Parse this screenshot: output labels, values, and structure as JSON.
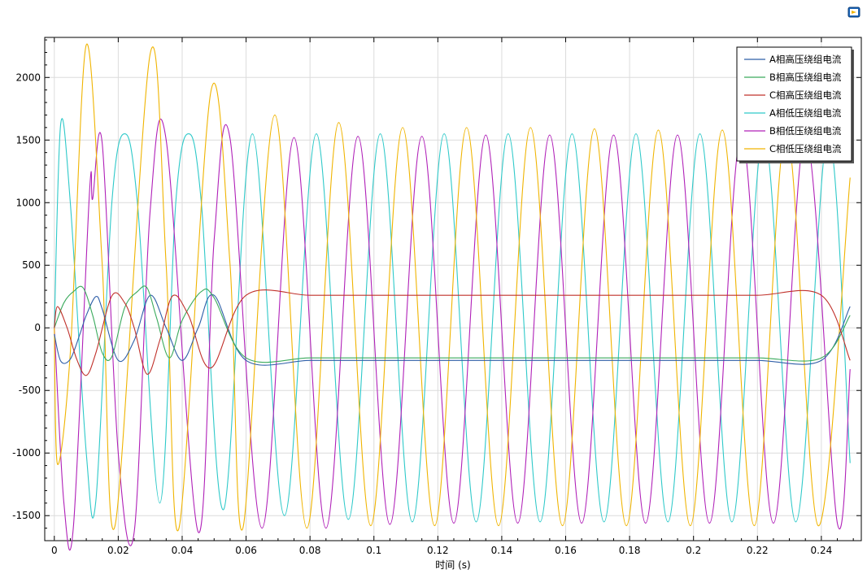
{
  "chart_data": {
    "type": "line",
    "xlabel": "时间 (s)",
    "ylabel": "",
    "xlim": [
      -0.003,
      0.2525
    ],
    "ylim": [
      -1700,
      2320
    ],
    "xticks": [
      0,
      0.02,
      0.04,
      0.06,
      0.08,
      0.1,
      0.12,
      0.14,
      0.16,
      0.18,
      0.2,
      0.22,
      0.24
    ],
    "xtick_labels": [
      "0",
      "0.02",
      "0.04",
      "0.06",
      "0.08",
      "0.1",
      "0.12",
      "0.14",
      "0.16",
      "0.18",
      "0.2",
      "0.22",
      "0.24"
    ],
    "yticks": [
      -1500,
      -1000,
      -500,
      0,
      500,
      1000,
      1500,
      2000
    ],
    "ytick_labels": [
      "-1500",
      "-1000",
      "-500",
      "0",
      "500",
      "1000",
      "1500",
      "2000"
    ],
    "grid": true,
    "legend_position": "top-right",
    "series": [
      {
        "name": "A相高压绕组电流",
        "color": "#2f5fa8",
        "x": [
          0,
          0.002,
          0.005,
          0.008,
          0.01,
          0.013,
          0.015,
          0.02,
          0.025,
          0.03,
          0.035,
          0.04,
          0.045,
          0.05,
          0.06,
          0.08,
          0.1,
          0.12,
          0.14,
          0.16,
          0.18,
          0.2,
          0.22,
          0.24,
          0.249
        ],
        "y": [
          -50,
          -265,
          -250,
          -50,
          100,
          250,
          150,
          -260,
          -100,
          260,
          0,
          -260,
          0,
          260,
          -260,
          -260,
          -260,
          -260,
          -260,
          -260,
          -260,
          -260,
          -260,
          -260,
          170
        ]
      },
      {
        "name": "B相高压绕组电流",
        "color": "#3aaa5c",
        "x": [
          0,
          0.003,
          0.006,
          0.009,
          0.012,
          0.015,
          0.018,
          0.022,
          0.026,
          0.029,
          0.032,
          0.036,
          0.04,
          0.046,
          0.05,
          0.06,
          0.08,
          0.1,
          0.12,
          0.14,
          0.16,
          0.18,
          0.2,
          0.22,
          0.24,
          0.249
        ],
        "y": [
          0,
          200,
          290,
          320,
          100,
          -200,
          -230,
          160,
          290,
          320,
          80,
          -240,
          60,
          290,
          240,
          -240,
          -240,
          -240,
          -240,
          -240,
          -240,
          -240,
          -240,
          -240,
          -240,
          100
        ]
      },
      {
        "name": "C相高压绕组电流",
        "color": "#c0302a",
        "x": [
          0,
          0.001,
          0.004,
          0.007,
          0.01,
          0.013,
          0.018,
          0.022,
          0.025,
          0.029,
          0.033,
          0.037,
          0.042,
          0.049,
          0.06,
          0.08,
          0.1,
          0.12,
          0.14,
          0.16,
          0.18,
          0.2,
          0.22,
          0.24,
          0.249
        ],
        "y": [
          0,
          170,
          0,
          -250,
          -380,
          -200,
          255,
          200,
          0,
          -370,
          -100,
          255,
          100,
          -320,
          260,
          260,
          260,
          260,
          260,
          260,
          260,
          260,
          260,
          260,
          -260
        ]
      },
      {
        "name": "A相低压绕组电流",
        "color": "#2ec9c9",
        "x": [
          0,
          0.002,
          0.005,
          0.01,
          0.013,
          0.018,
          0.022,
          0.026,
          0.033,
          0.038,
          0.042,
          0.046,
          0.053,
          0.062,
          0.072,
          0.082,
          0.092,
          0.102,
          0.112,
          0.122,
          0.132,
          0.142,
          0.152,
          0.162,
          0.172,
          0.182,
          0.192,
          0.202,
          0.212,
          0.222,
          0.232,
          0.242,
          0.249
        ],
        "y": [
          0,
          1630,
          1000,
          -1000,
          -1380,
          1000,
          1550,
          1000,
          -1400,
          1000,
          1550,
          1000,
          -1450,
          1550,
          -1500,
          1550,
          -1530,
          1550,
          -1550,
          1550,
          -1550,
          1550,
          -1550,
          1550,
          -1550,
          1550,
          -1550,
          1550,
          -1550,
          1550,
          -1550,
          1550,
          -1080
        ]
      },
      {
        "name": "B相低压绕组电流",
        "color": "#b020b8",
        "x": [
          0,
          0.003,
          0.006,
          0.011,
          0.012,
          0.015,
          0.02,
          0.025,
          0.03,
          0.035,
          0.045,
          0.05,
          0.055,
          0.065,
          0.075,
          0.085,
          0.095,
          0.105,
          0.115,
          0.125,
          0.135,
          0.145,
          0.155,
          0.165,
          0.175,
          0.185,
          0.195,
          0.205,
          0.215,
          0.225,
          0.235,
          0.245,
          0.249
        ],
        "y": [
          0,
          -1400,
          -1580,
          1080,
          1030,
          1470,
          -1000,
          -1630,
          940,
          1500,
          -1630,
          700,
          1510,
          -1600,
          1520,
          -1600,
          1530,
          -1570,
          1530,
          -1560,
          1540,
          -1560,
          1540,
          -1560,
          1540,
          -1560,
          1540,
          -1560,
          1540,
          -1560,
          1540,
          -1560,
          -330
        ]
      },
      {
        "name": "C相低压绕组电流",
        "color": "#f0b400",
        "x": [
          0,
          0.001,
          0.005,
          0.01,
          0.015,
          0.019,
          0.03,
          0.035,
          0.039,
          0.049,
          0.055,
          0.059,
          0.069,
          0.079,
          0.089,
          0.099,
          0.109,
          0.119,
          0.129,
          0.139,
          0.149,
          0.159,
          0.169,
          0.179,
          0.189,
          0.199,
          0.209,
          0.219,
          0.229,
          0.239,
          0.249
        ],
        "y": [
          0,
          -1090,
          -200,
          2260,
          500,
          -1580,
          2190,
          500,
          -1600,
          1890,
          500,
          -1600,
          1700,
          -1600,
          1640,
          -1580,
          1600,
          -1580,
          1600,
          -1580,
          1600,
          -1580,
          1590,
          -1580,
          1580,
          -1580,
          1580,
          -1580,
          1570,
          -1580,
          1200
        ]
      }
    ]
  }
}
